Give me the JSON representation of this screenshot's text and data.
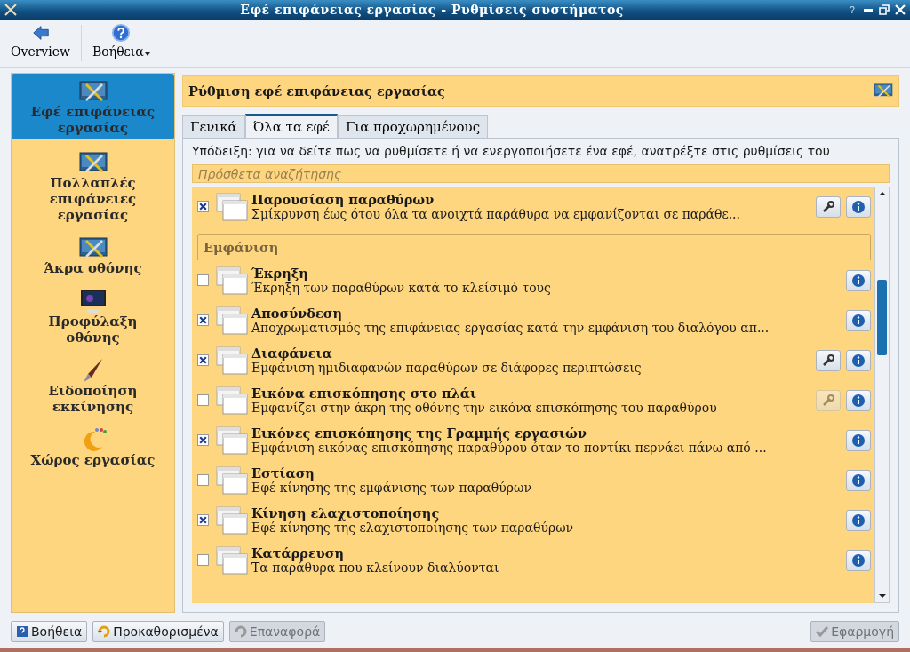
{
  "window": {
    "title": "Εφέ επιφάνειας εργασίας - Ρυθμίσεις συστήματος",
    "help_glyph": "?"
  },
  "toolbar": [
    {
      "label": "Overview",
      "kind": "back"
    },
    {
      "label": "Βοήθεια",
      "kind": "help"
    }
  ],
  "sidebar": {
    "items": [
      {
        "label": "Εφέ επιφάνειας εργασίας",
        "selected": true
      },
      {
        "label": "Πολλαπλές επιφάνειες εργασίας",
        "selected": false
      },
      {
        "label": "Άκρα οθόνης",
        "selected": false
      },
      {
        "label": "Προφύλαξη οθόνης",
        "selected": false
      },
      {
        "label": "Ειδοποίηση εκκίνησης",
        "selected": false
      },
      {
        "label": "Χώρος εργασίας",
        "selected": false
      }
    ]
  },
  "header": {
    "title": "Ρύθμιση εφέ επιφάνειας εργασίας"
  },
  "tabs": [
    {
      "label": "Γενικά",
      "selected": false
    },
    {
      "label": "Όλα τα εφέ",
      "selected": true
    },
    {
      "label": "Για προχωρημένους",
      "selected": false
    }
  ],
  "hint": "Υπόδειξη: για να δείτε πως να ρυθμίσετε ή να ενεργοποιήσετε ένα εφέ, ανατρέξτε στις ρυθμίσεις του",
  "search": {
    "placeholder": "Πρόσθετα αναζήτησης"
  },
  "effects": [
    {
      "kind": "effect",
      "title": "Παρουσίαση παραθύρων",
      "description": "Σμίκρυνση έως ότου όλα τα ανοιχτά παράθυρα να εμφανίζονται σε παράθε...",
      "checked": true,
      "settings": true,
      "settings_disabled": false
    },
    {
      "kind": "group",
      "title": "Εμφάνιση"
    },
    {
      "kind": "effect",
      "title": "Έκρηξη",
      "description": "Έκρηξη των παραθύρων κατά το κλείσιμό τους",
      "checked": false,
      "settings": false
    },
    {
      "kind": "effect",
      "title": "Αποσύνδεση",
      "description": "Αποχρωματισμός της επιφάνειας εργασίας κατά την εμφάνιση του διαλόγου απ...",
      "checked": true,
      "settings": false
    },
    {
      "kind": "effect",
      "title": "Διαφάνεια",
      "description": "Εμφάνιση ημιδιαφανών παραθύρων σε διάφορες περιπτώσεις",
      "checked": true,
      "settings": true,
      "settings_disabled": false
    },
    {
      "kind": "effect",
      "title": "Εικόνα επισκόπησης στο πλάι",
      "description": "Εμφανίζει στην άκρη της οθόνης την εικόνα επισκόπησης του παραθύρου",
      "checked": false,
      "settings": true,
      "settings_disabled": true
    },
    {
      "kind": "effect",
      "title": "Εικόνες επισκόπησης της Γραμμής εργασιών",
      "description": "Εμφάνιση εικόνας επισκόπησης παραθύρου όταν το ποντίκι περνάει πάνω από ...",
      "checked": true,
      "settings": false
    },
    {
      "kind": "effect",
      "title": "Εστίαση",
      "description": "Εφέ κίνησης της εμφάνισης των παραθύρων",
      "checked": false,
      "settings": false
    },
    {
      "kind": "effect",
      "title": "Κίνηση ελαχιστοποίησης",
      "description": "Εφέ κίνησης της ελαχιστοποίησης των παραθύρων",
      "checked": true,
      "settings": false
    },
    {
      "kind": "effect",
      "title": "Κατάρρευση",
      "description": "Τα παράθυρα που κλείνουν διαλύονται",
      "checked": false,
      "settings": false
    }
  ],
  "buttons": [
    {
      "label": "Βοήθεια",
      "kind": "help",
      "disabled": false
    },
    {
      "label": "Προκαθορισμένα",
      "kind": "defaults",
      "disabled": false
    },
    {
      "label": "Επαναφορά",
      "kind": "reset",
      "disabled": true
    },
    {
      "label": "Εφαρμογή",
      "kind": "apply",
      "disabled": true
    }
  ]
}
